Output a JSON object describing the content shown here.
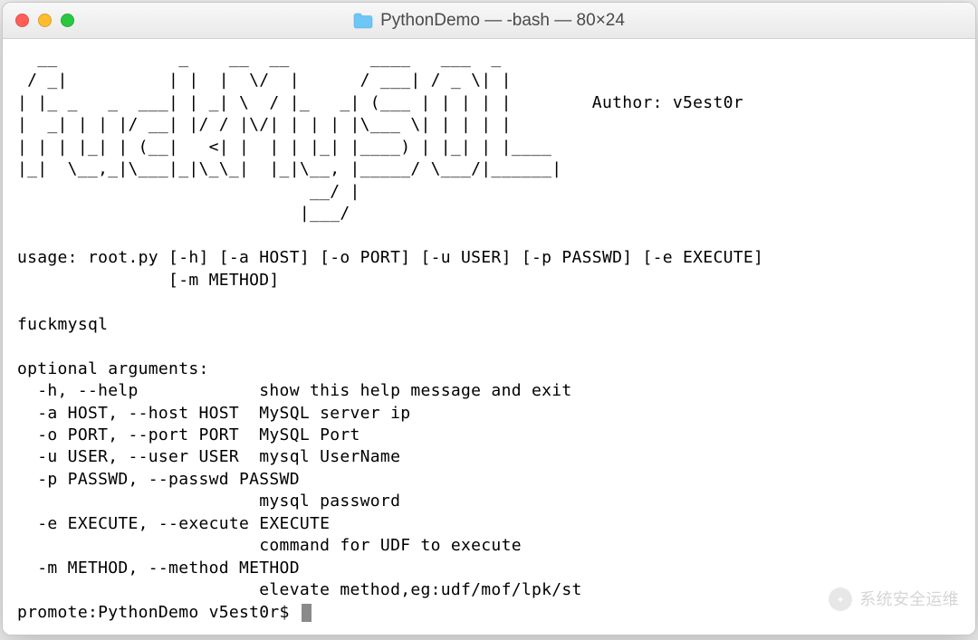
{
  "window": {
    "title": "PythonDemo — -bash — 80×24"
  },
  "ascii_art": "  __            _    __  __        ____   ___  _\n / _|          | |  |  \\/  |      / ___| / _ \\| |\n| |_ _   _  ___| | _| \\  / |_   _| (___ | | | | |        Author: v5est0r\n|  _| | | |/ __| |/ / |\\/| | | | |\\___ \\| | | | |\n| | | |_| | (__|   <| |  | | |_| |____) | |_| | |____\n|_|  \\__,_|\\___|_|\\_\\_|  |_|\\__, |_____/ \\___/|______|\n                             __/ |\n                            |___/",
  "usage_line1": "usage: root.py [-h] [-a HOST] [-o PORT] [-u USER] [-p PASSWD] [-e EXECUTE]",
  "usage_line2": "               [-m METHOD]",
  "prog_name": "fuckmysql",
  "opt_header": "optional arguments:",
  "opt1": "  -h, --help            show this help message and exit",
  "opt2": "  -a HOST, --host HOST  MySQL server ip",
  "opt3": "  -o PORT, --port PORT  MySQL Port",
  "opt4": "  -u USER, --user USER  mysql UserName",
  "opt5a": "  -p PASSWD, --passwd PASSWD",
  "opt5b": "                        mysql password",
  "opt6a": "  -e EXECUTE, --execute EXECUTE",
  "opt6b": "                        command for UDF to execute",
  "opt7a": "  -m METHOD, --method METHOD",
  "opt7b": "                        elevate method,eg:udf/mof/lpk/st",
  "prompt": "promote:PythonDemo v5est0r$ ",
  "watermark": "系统安全运维"
}
